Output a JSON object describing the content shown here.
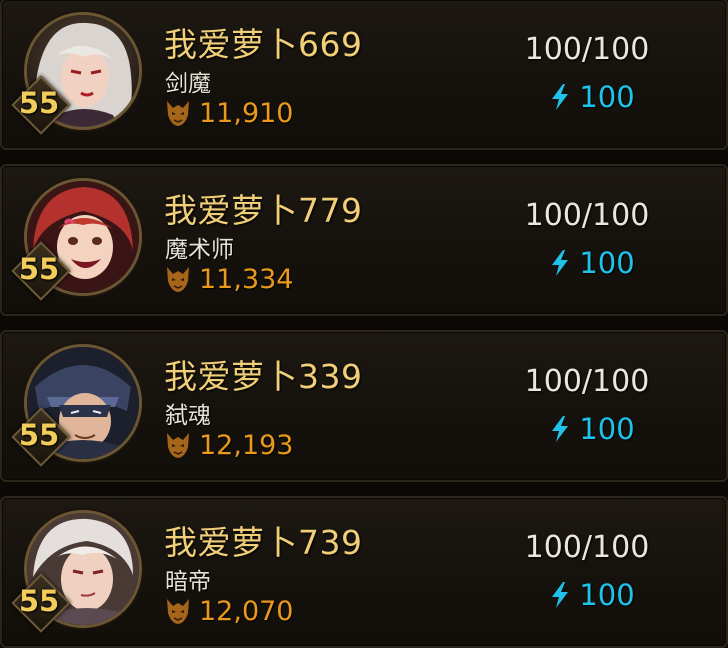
{
  "colors": {
    "name": "#f1cf79",
    "class": "#e8e2d6",
    "power": "#e99a1c",
    "stamina": "#ece7dc",
    "energy": "#1fc2ea",
    "level": "#f2cd5a",
    "row_bg": "#18130e",
    "row_border": "#2c251c"
  },
  "icons": {
    "power": "demon-mask-icon",
    "energy": "lightning-bolt-icon",
    "level": "diamond-badge"
  },
  "characters": [
    {
      "name": "我爱萝卜669",
      "class": "剑魔",
      "power": "11,910",
      "stamina": "100/100",
      "energy": "100",
      "level": "55"
    },
    {
      "name": "我爱萝卜779",
      "class": "魔术师",
      "power": "11,334",
      "stamina": "100/100",
      "energy": "100",
      "level": "55"
    },
    {
      "name": "我爱萝卜339",
      "class": "弑魂",
      "power": "12,193",
      "stamina": "100/100",
      "energy": "100",
      "level": "55"
    },
    {
      "name": "我爱萝卜739",
      "class": "暗帝",
      "power": "12,070",
      "stamina": "100/100",
      "energy": "100",
      "level": "55"
    }
  ]
}
